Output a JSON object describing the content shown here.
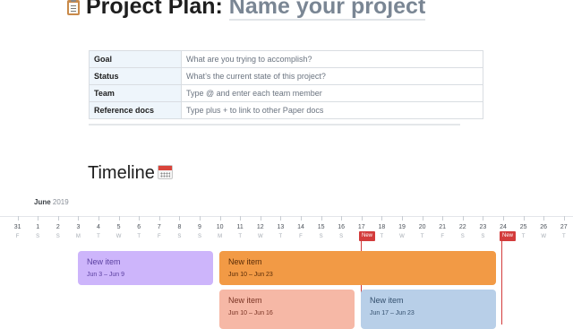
{
  "header": {
    "title": "Project Plan:",
    "title_placeholder": "Name your project",
    "title_icon": "clipboard-icon"
  },
  "properties": [
    {
      "key": "Goal",
      "value": "What are you trying to accomplish?"
    },
    {
      "key": "Status",
      "value": "What’s the current state of this project?"
    },
    {
      "key": "Team",
      "value": "Type @ and enter each team member"
    },
    {
      "key": "Reference docs",
      "value": "Type plus + to link to other Paper docs"
    }
  ],
  "timeline": {
    "heading": "Timeline",
    "heading_icon": "calendar-icon",
    "month": "June",
    "year": "2019",
    "days": [
      {
        "n": "1",
        "w": ""
      },
      {
        "n": "31",
        "w": "F"
      },
      {
        "n": "1",
        "w": "S"
      },
      {
        "n": "2",
        "w": "S"
      },
      {
        "n": "3",
        "w": "M"
      },
      {
        "n": "4",
        "w": "T"
      },
      {
        "n": "5",
        "w": "W"
      },
      {
        "n": "6",
        "w": "T"
      },
      {
        "n": "7",
        "w": "F"
      },
      {
        "n": "8",
        "w": "S"
      },
      {
        "n": "9",
        "w": "S"
      },
      {
        "n": "10",
        "w": "M"
      },
      {
        "n": "11",
        "w": "T"
      },
      {
        "n": "12",
        "w": "W"
      },
      {
        "n": "13",
        "w": "T"
      },
      {
        "n": "14",
        "w": "F"
      },
      {
        "n": "15",
        "w": "S"
      },
      {
        "n": "16",
        "w": "S"
      },
      {
        "n": "17",
        "w": "M"
      },
      {
        "n": "18",
        "w": "T"
      },
      {
        "n": "19",
        "w": "W"
      },
      {
        "n": "20",
        "w": "T"
      },
      {
        "n": "21",
        "w": "F"
      },
      {
        "n": "22",
        "w": "S"
      },
      {
        "n": "23",
        "w": "S"
      },
      {
        "n": "24",
        "w": "M"
      },
      {
        "n": "25",
        "w": "T"
      },
      {
        "n": "26",
        "w": "W"
      },
      {
        "n": "27",
        "w": "T"
      }
    ],
    "markers": [
      {
        "label": "New",
        "color": "#d33b3b"
      },
      {
        "label": "New",
        "color": "#d33b3b"
      }
    ],
    "items": [
      {
        "title": "New item",
        "dates": "Jun 3 – Jun 9",
        "color": "#cdb5fb",
        "text_color": "#5a3fa0"
      },
      {
        "title": "New item",
        "dates": "Jun 10 – Jun 23",
        "color": "#f29a45",
        "text_color": "#5a2c07"
      },
      {
        "title": "New item",
        "dates": "Jun 10 – Jun 16",
        "color": "#f6b8a6",
        "text_color": "#7a3424"
      },
      {
        "title": "New item",
        "dates": "Jun 17 – Jun 23",
        "color": "#b8cfe8",
        "text_color": "#34506e"
      }
    ]
  }
}
